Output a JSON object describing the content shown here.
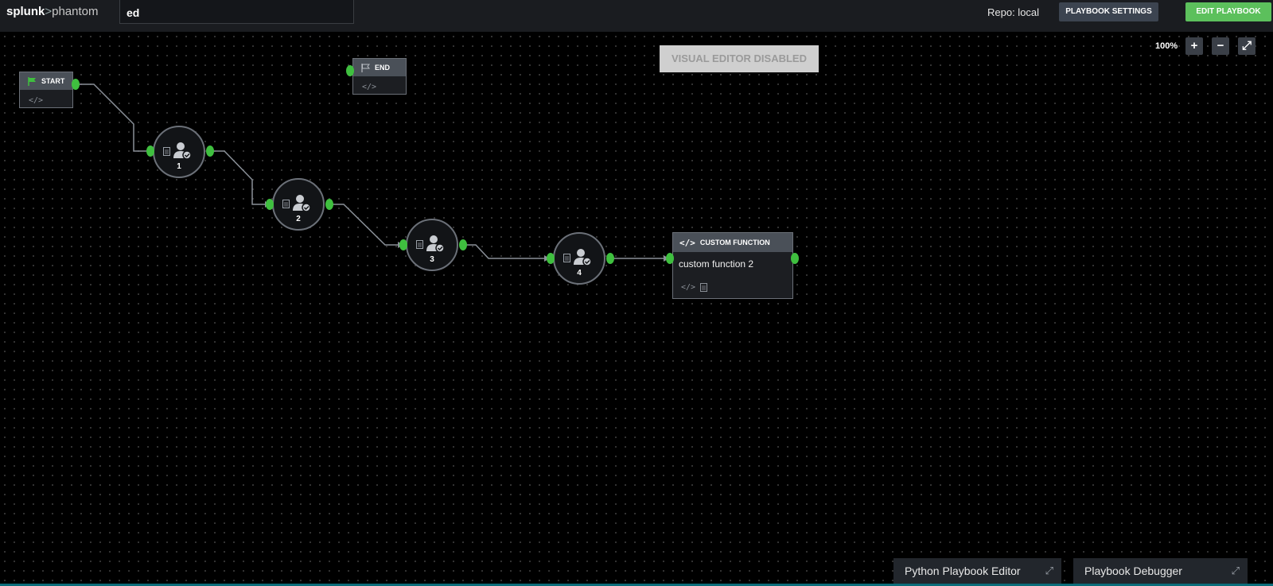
{
  "header": {
    "logo_brand": "splunk",
    "logo_sep": ">",
    "logo_product": "phantom",
    "playbook_name": "ed",
    "repo": "Repo: local",
    "settings_label": "PLAYBOOK SETTINGS",
    "edit_label": "EDIT PLAYBOOK"
  },
  "canvas": {
    "disabled_label": "VISUAL EDITOR DISABLED",
    "zoom_level": "100%",
    "zoom_in": "+",
    "zoom_out": "−",
    "fit": "⤢"
  },
  "nodes": {
    "start": {
      "label": "START",
      "icon": "flag-icon",
      "code": "</>"
    },
    "end": {
      "label": "END",
      "icon": "flag-outline-icon",
      "code": "</>"
    },
    "prompts": [
      {
        "number": "1",
        "icon": "user-check-icon"
      },
      {
        "number": "2",
        "icon": "user-check-icon"
      },
      {
        "number": "3",
        "icon": "user-check-icon"
      },
      {
        "number": "4",
        "icon": "user-check-icon"
      }
    ],
    "custom_function": {
      "title": "CUSTOM FUNCTION",
      "code_icon": "</>",
      "name": "custom function 2",
      "footer_code": "</>"
    }
  },
  "bottom_tabs": {
    "python_editor": "Python Playbook Editor",
    "debugger": "Playbook Debugger"
  },
  "colors": {
    "accent_green": "#3fbf3f",
    "edit_button": "#5cc05c",
    "node_border": "#6b7078",
    "header_bar": "#1a1c20"
  }
}
